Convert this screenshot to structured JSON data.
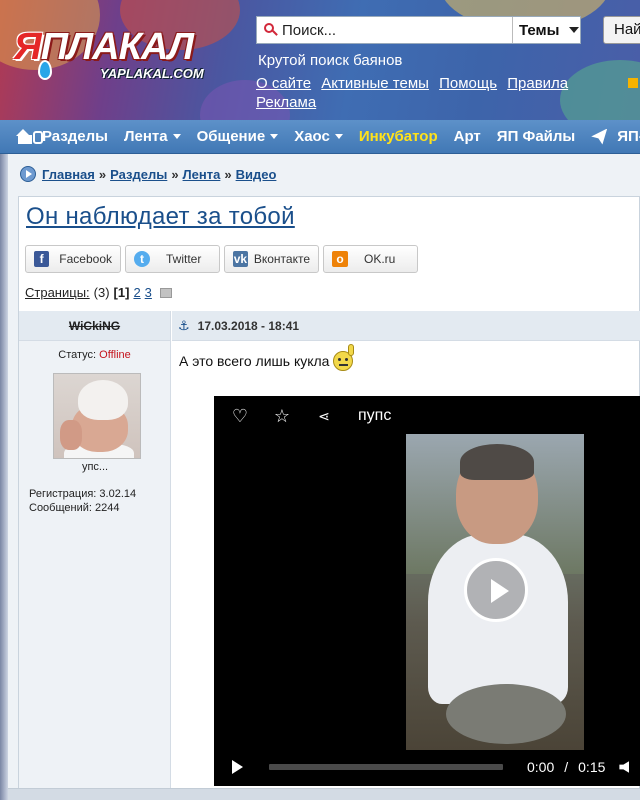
{
  "header": {
    "logo_main": "ЯПЛАКАЛ",
    "logo_ya": "Я",
    "logo_rest": "ПЛАКАЛ",
    "logo_sub": "YAPLAKAL.COM",
    "search_placeholder": "Поиск...",
    "search_scope": "Темы",
    "search_button": "Най",
    "tagline": "Крутой поиск баянов",
    "links": [
      "О сайте",
      "Активные темы",
      "Помощь",
      "Правила",
      "Реклама"
    ]
  },
  "nav": {
    "items": [
      {
        "label": "Разделы",
        "caret": false,
        "highlight": false
      },
      {
        "label": "Лента",
        "caret": true,
        "highlight": false
      },
      {
        "label": "Общение",
        "caret": true,
        "highlight": false
      },
      {
        "label": "Хаос",
        "caret": true,
        "highlight": false
      },
      {
        "label": "Инкубатор",
        "caret": false,
        "highlight": true
      },
      {
        "label": "Арт",
        "caret": false,
        "highlight": false
      },
      {
        "label": "ЯП Файлы",
        "caret": false,
        "highlight": false
      },
      {
        "label": "ЯП-",
        "caret": false,
        "highlight": false
      }
    ]
  },
  "breadcrumb": [
    "Главная",
    "Разделы",
    "Лента",
    "Видео"
  ],
  "topic": {
    "title": "Он наблюдает за тобой"
  },
  "share": [
    "Facebook",
    "Twitter",
    "Вконтакте",
    "OK.ru"
  ],
  "pages": {
    "label": "Страницы:",
    "count": "(3)",
    "current": "[1]",
    "others": [
      "2",
      "3"
    ]
  },
  "post": {
    "author": "WiCkiNG",
    "status_label": "Статус:",
    "status_value": "Offline",
    "avatar_caption": "упс...",
    "registration": "Регистрация: 3.02.14",
    "messages": "Сообщений: 2244",
    "datetime": "17.03.2018 - 18:41",
    "text": "А это всего лишь кукла"
  },
  "video": {
    "title": "пупс",
    "current_time": "0:00",
    "separator": "/",
    "duration": "0:15",
    "progress": 0
  },
  "colors": {
    "nav_bg": "#4a82bf",
    "link": "#1a4f8b",
    "highlight": "#ffe21a",
    "offline": "#c5131d"
  }
}
